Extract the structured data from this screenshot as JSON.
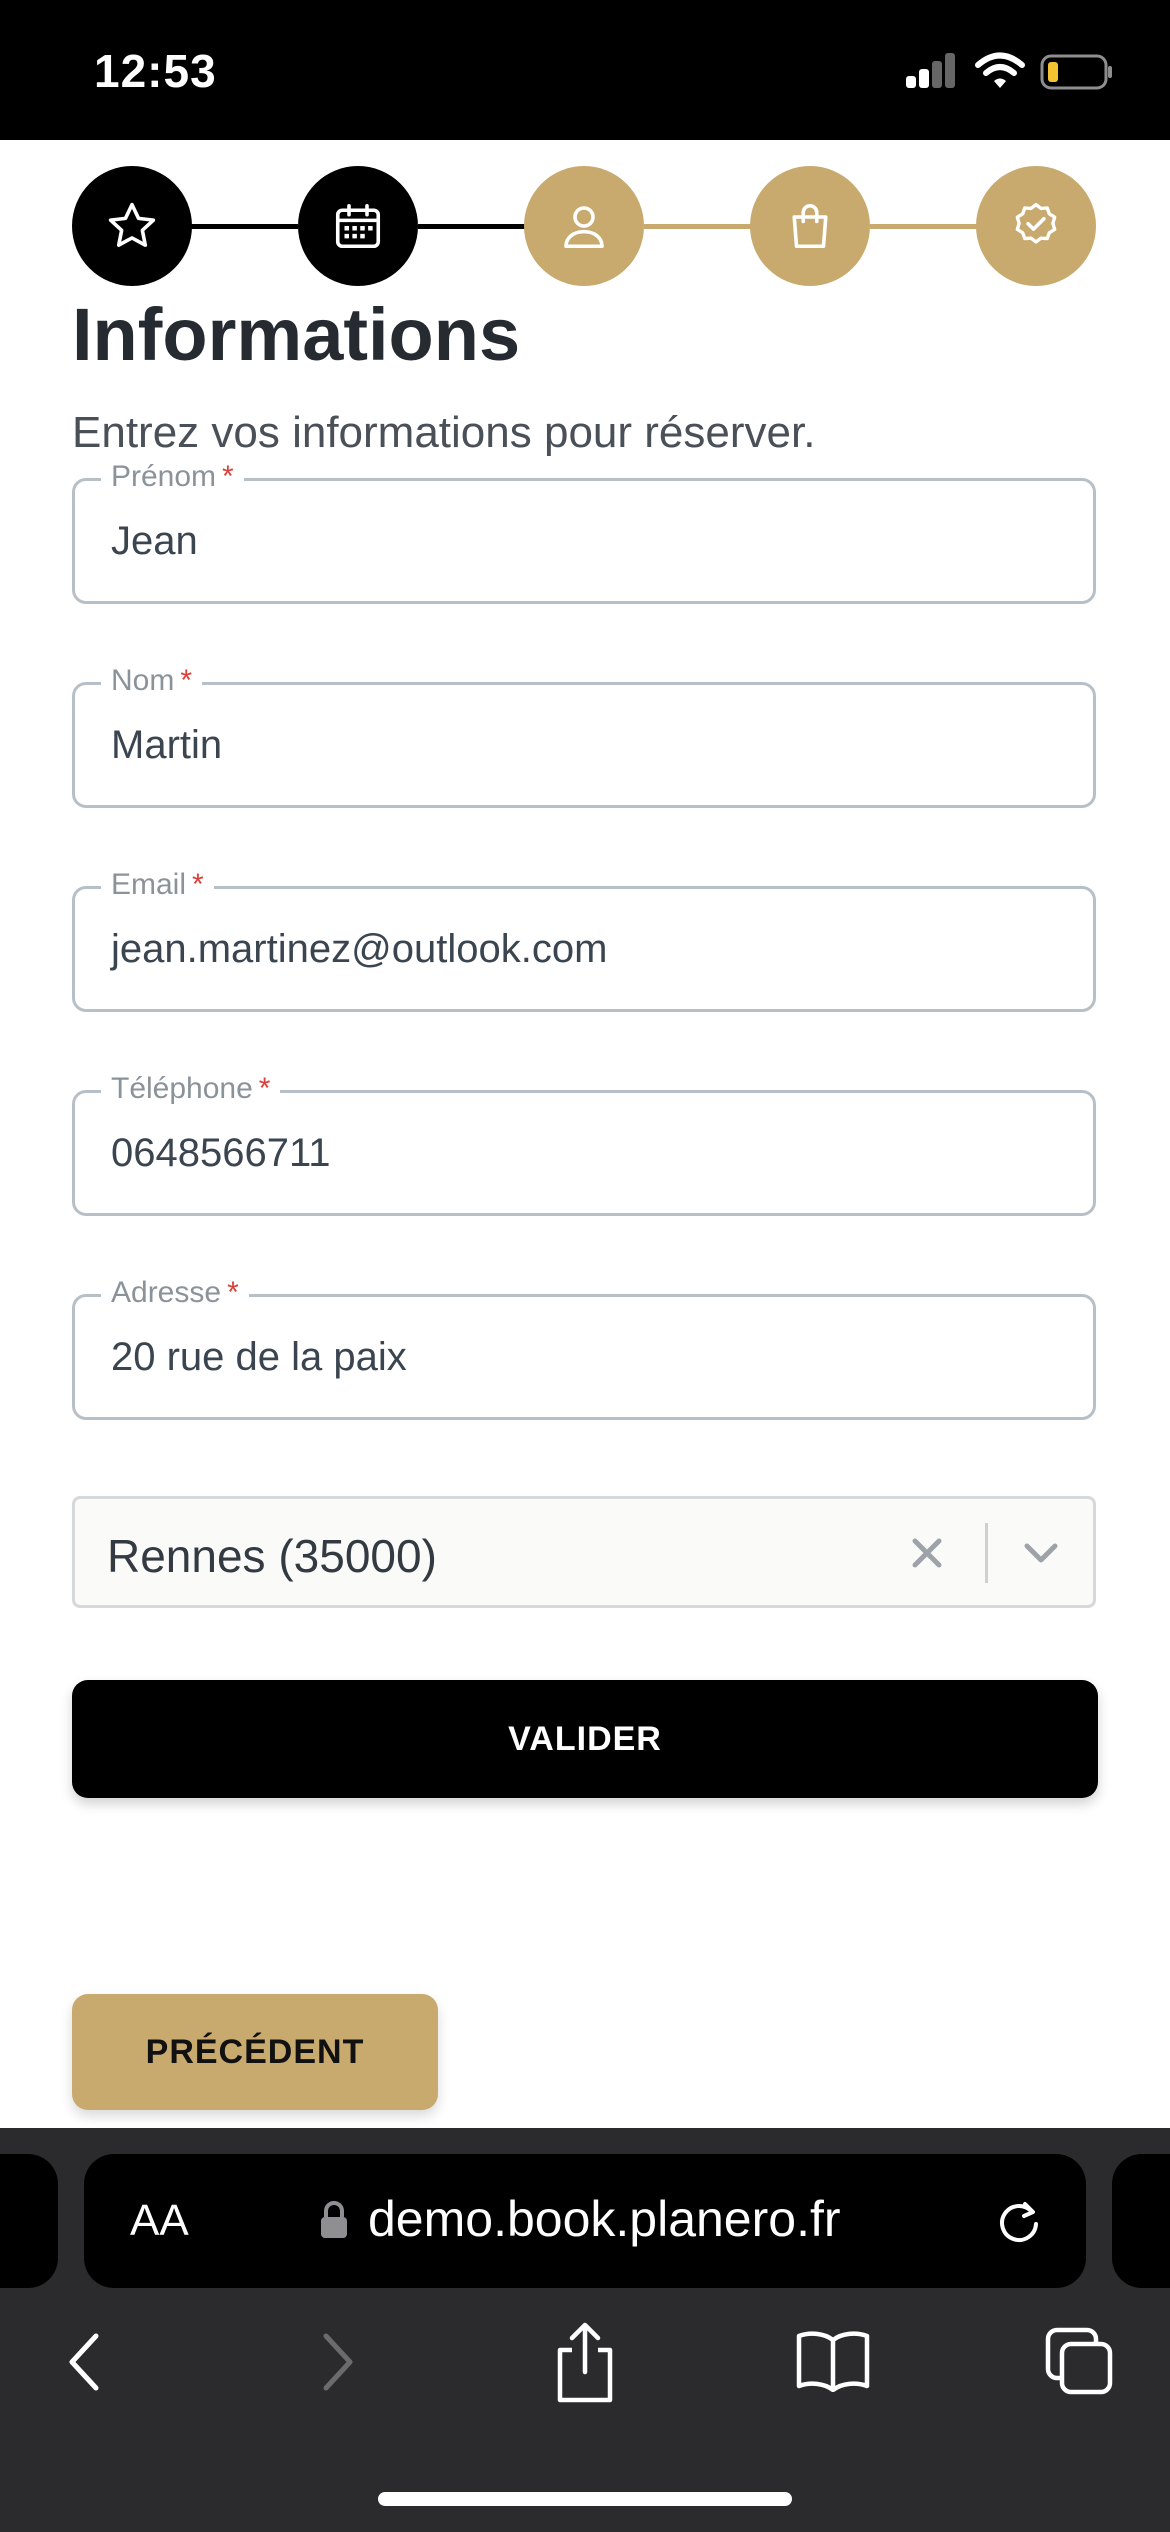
{
  "status_bar": {
    "time": "12:53"
  },
  "stepper": {
    "steps": [
      {
        "icon": "star-icon",
        "state": "done"
      },
      {
        "icon": "calendar-icon",
        "state": "done"
      },
      {
        "icon": "user-icon",
        "state": "current"
      },
      {
        "icon": "shopping-bag-icon",
        "state": "pending"
      },
      {
        "icon": "badge-check-icon",
        "state": "pending"
      }
    ],
    "done_color": "#000000",
    "pending_color": "#c8aa6e"
  },
  "page": {
    "title": "Informations",
    "subtitle": "Entrez vos informations pour réserver."
  },
  "form": {
    "required_marker": "*",
    "first_name": {
      "label": "Prénom",
      "value": "Jean"
    },
    "last_name": {
      "label": "Nom",
      "value": "Martin"
    },
    "email": {
      "label": "Email",
      "value": "jean.martinez@outlook.com"
    },
    "phone": {
      "label": "Téléphone",
      "value": "0648566711"
    },
    "address": {
      "label": "Adresse",
      "value": "20 rue de la paix"
    },
    "city": {
      "value": "Rennes (35000)"
    }
  },
  "buttons": {
    "submit": "VALIDER",
    "previous": "PRÉCÉDENT"
  },
  "browser": {
    "text_size_label": "AA",
    "url": "demo.book.planero.fr"
  },
  "colors": {
    "accent_gold": "#c8aa6e",
    "required_red": "#d9413a"
  }
}
